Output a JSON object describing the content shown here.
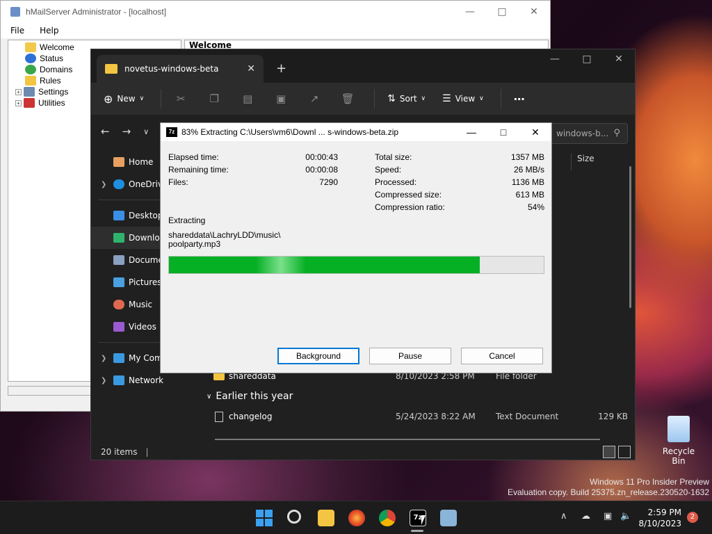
{
  "hmail": {
    "title": "hMailServer Administrator - [localhost]",
    "menu": [
      "File",
      "Help"
    ],
    "tree": [
      "Welcome",
      "Status",
      "Domains",
      "Rules",
      "Settings",
      "Utilities"
    ],
    "right_header": "Welcome"
  },
  "explorer": {
    "tab_title": "novetus-windows-beta",
    "commands": {
      "new": "New",
      "sort": "Sort",
      "view": "View"
    },
    "search_text": "windows-b...",
    "column_size": "Size",
    "nav": [
      "Home",
      "OneDrive",
      "Desktop",
      "Downloads",
      "Documents",
      "Pictures",
      "Music",
      "Videos",
      "My Computer",
      "Network"
    ],
    "rows": [
      {
        "name": "shareddata",
        "date": "8/10/2023 2:58 PM",
        "type": "File folder",
        "size": ""
      },
      {
        "name": "changelog",
        "date": "5/24/2023 8:22 AM",
        "type": "Text Document",
        "size": "129 KB"
      }
    ],
    "group_label": "Earlier this year",
    "status": "20 items"
  },
  "zip": {
    "title": "83% Extracting C:\\Users\\vm6\\Downl ... s-windows-beta.zip",
    "left_labels": [
      "Elapsed time:",
      "Remaining time:",
      "Files:"
    ],
    "left_values": [
      "00:00:43",
      "00:00:08",
      "7290"
    ],
    "right_labels": [
      "Total size:",
      "Speed:",
      "Processed:",
      "Compressed size:",
      "Compression ratio:"
    ],
    "right_values": [
      "1357 MB",
      "26 MB/s",
      "1136 MB",
      "613 MB",
      "54%"
    ],
    "extracting_label": "Extracting",
    "path_line1": "shareddata\\LachryLDD\\music\\",
    "path_line2": "poolparty.mp3",
    "progress": 0.83,
    "buttons": {
      "background": "Background",
      "pause": "Pause",
      "cancel": "Cancel"
    }
  },
  "desktop": {
    "recycle_bin": "Recycle Bin",
    "watermark1": "Windows 11 Pro Insider Preview",
    "watermark2": "Evaluation copy. Build 25375.zn_release.230520-1632"
  },
  "taskbar": {
    "time": "2:59 PM",
    "date": "8/10/2023",
    "notification_count": "2",
    "zip_icon_text": "7z"
  }
}
